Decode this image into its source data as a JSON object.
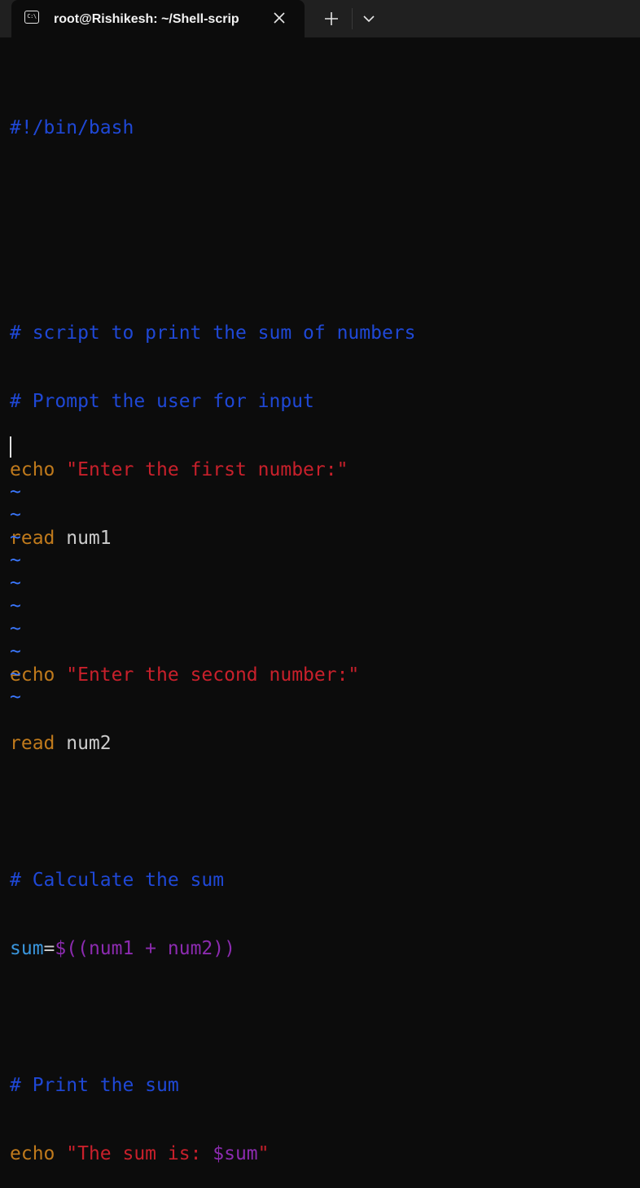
{
  "window": {
    "tab_title": "root@Rishikesh: ~/Shell-scrip",
    "tab_icon_glyph": "C:\\",
    "tab_icon": "terminal-icon",
    "close_icon": "close-icon",
    "new_tab_icon": "plus-icon",
    "dropdown_icon": "chevron-down-icon"
  },
  "editor": {
    "shebang": "#!/bin/bash",
    "comment1": "# script to print the sum of numbers",
    "comment2": "# Prompt the user for input",
    "echo1_kw": "echo",
    "echo1_str": "\"Enter the first number:\"",
    "read1_kw": "read",
    "read1_var": " num1",
    "echo2_kw": "echo",
    "echo2_str": "\"Enter the second number:\"",
    "read2_kw": "read",
    "read2_var": " num2",
    "comment3": "# Calculate the sum",
    "assign_var": "sum",
    "assign_eq": "=",
    "assign_expr": "$((num1 + num2))",
    "comment4": "# Print the sum",
    "echo3_kw": "echo",
    "echo3_str_a": "\"The sum is: ",
    "echo3_var": "$sum",
    "echo3_str_b": "\"",
    "tilde": "~",
    "tilde_count": 10
  },
  "colors": {
    "background": "#0c0c0c",
    "comment": "#1f48d6",
    "keyword": "#c07a1c",
    "string": "#c8202b",
    "variable": "#3a96dd",
    "arith": "#8c2bb0",
    "tilde": "#3b78ff"
  }
}
